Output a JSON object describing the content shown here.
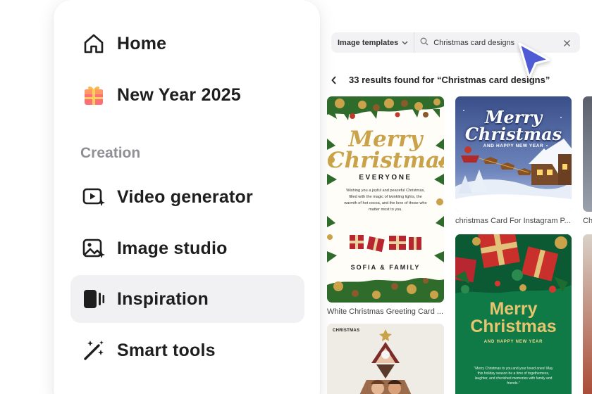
{
  "menu": {
    "items": [
      {
        "label": "Home"
      },
      {
        "label": "New Year 2025"
      },
      {
        "label": "Video generator"
      },
      {
        "label": "Image studio"
      },
      {
        "label": "Inspiration"
      },
      {
        "label": "Smart tools"
      }
    ],
    "section_creation": "Creation"
  },
  "toolbar": {
    "dropdown_label": "Image templates",
    "search_value": "Christmas card designs"
  },
  "results": {
    "summary": "33 results found for “Christmas card designs”"
  },
  "cards": [
    {
      "caption": "White Christmas Greeting Card ...",
      "title_line1": "Merry",
      "title_line2": "Christmas",
      "subtitle": "EVERYONE",
      "message": "Wishing you a joyful and peaceful Christmas, filled with the magic of twinkling lights, the warmth of hot cocoa, and the love of those who matter most to you.",
      "signature": "SOFIA & FAMILY"
    },
    {
      "caption": "christmas Card For Instagram P...",
      "title_line1": "Merry",
      "title_line2": "Christmas",
      "subtitle": "AND HAPPY NEW YEAR"
    },
    {
      "title_line1": "Merry",
      "title_line2": "Christmas",
      "subtitle": "AND HAPPY NEW YEAR",
      "message": "\"Merry Christmas to you and your loved ones! May this holiday season be a time of togetherness, laughter, and cherished memories with family and friends.\""
    },
    {
      "label": "CHRISTMAS"
    },
    {
      "caption": "Ch"
    }
  ],
  "colors": {
    "accent_cursor": "#4f5bd5",
    "active_item_bg": "#f1f1f3",
    "gold": "#c9a24a",
    "green_card": "#0f7a45"
  }
}
